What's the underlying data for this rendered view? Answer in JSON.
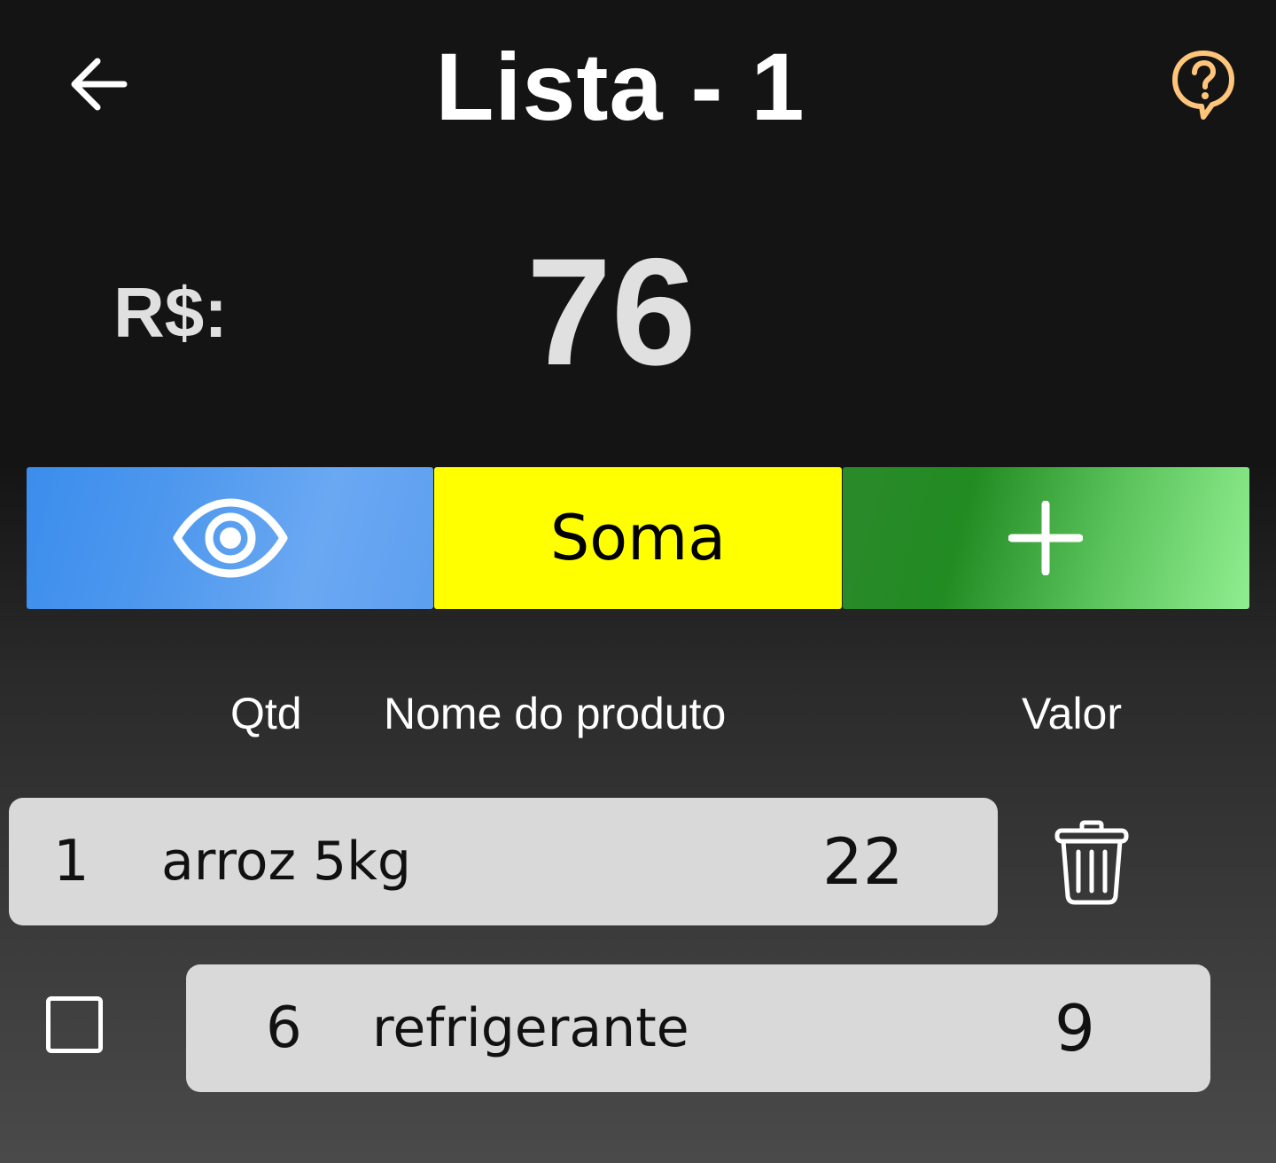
{
  "header": {
    "title": "Lista - 1",
    "back_icon": "arrow-left-icon",
    "help_icon": "help-question-bubble-icon"
  },
  "total": {
    "currency_label": "R$:",
    "value": "76"
  },
  "actions": {
    "view_icon": "eye-icon",
    "sum_label": "Soma",
    "add_icon": "plus-icon"
  },
  "columns": {
    "qty": "Qtd",
    "name": "Nome do produto",
    "value": "Valor"
  },
  "items": [
    {
      "qty": "1",
      "name": "arroz 5kg",
      "value": "22",
      "control": "trash-icon"
    },
    {
      "qty": "6",
      "name": "refrigerante",
      "value": "9",
      "control": "checkbox",
      "checked": false
    }
  ],
  "colors": {
    "background": "#141414",
    "title": "#ffffff",
    "help_icon": "#ffc57a",
    "view_button": "#4a95ee",
    "sum_button": "#ffff00",
    "add_button": "#228b22",
    "row_background": "#d9d9d9"
  }
}
